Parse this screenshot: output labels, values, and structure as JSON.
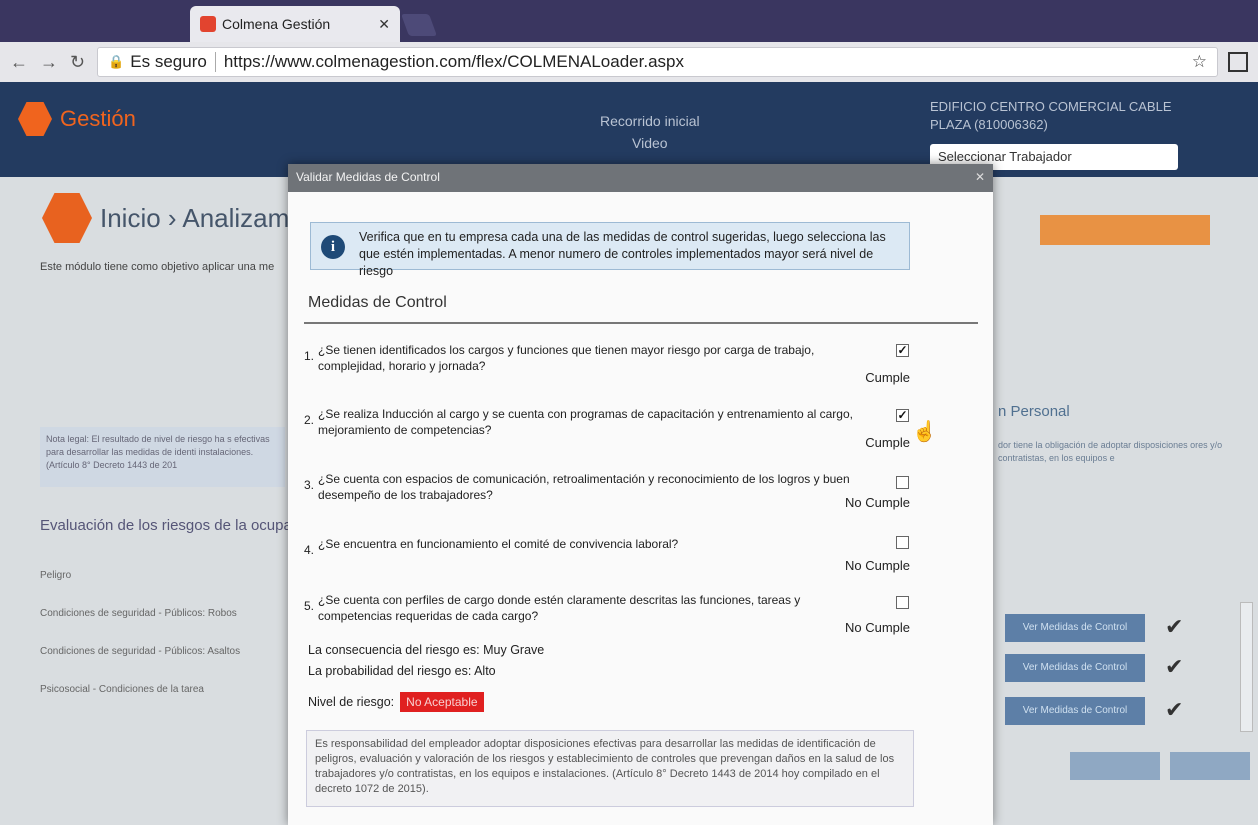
{
  "browser": {
    "tab_title": "Colmena Gestión",
    "secure_label": "Es seguro",
    "url": "https://www.colmenagestion.com/flex/COLMENALoader.aspx"
  },
  "app_header": {
    "logo_text": "Gestión",
    "tour_line1": "Recorrido inicial",
    "tour_line2": "Video",
    "company": "EDIFICIO CENTRO COMERCIAL CABLE PLAZA (810006362)",
    "worker_select": "Seleccionar Trabajador"
  },
  "background": {
    "breadcrumb": "Inicio  ›  Analizamos",
    "description": "Este módulo tiene como objetivo aplicar una me",
    "note": "Nota legal: El resultado de nivel de riesgo ha s efectivas para desarrollar las medidas de identi instalaciones. (Artículo 8° Decreto 1443 de 201",
    "section_title": "Evaluación de los riesgos de la ocupac",
    "table_header": "Peligro",
    "rows": [
      "Condiciones de seguridad - Públicos: Robos",
      "Condiciones de seguridad - Públicos: Asaltos",
      "Psicosocial - Condiciones de la tarea"
    ],
    "right_title": "n Personal",
    "right_note": "dor tiene la obligación de adoptar disposiciones ores y/o contratistas, en los equipos e",
    "ver_medidas_label": "Ver Medidas de Control"
  },
  "modal": {
    "title": "Validar Medidas de Control",
    "info": "Verifica que en tu empresa cada una de las medidas de control sugeridas, luego selecciona las que estén implementadas. A menor numero de controles implementados mayor será nivel de riesgo",
    "heading": "Medidas de Control",
    "questions": [
      {
        "num": "1.",
        "text": "¿Se tienen identificados los cargos y funciones que tienen mayor riesgo por carga de trabajo, complejidad, horario y jornada?",
        "checked": true,
        "status": "Cumple"
      },
      {
        "num": "2.",
        "text": "¿Se realiza Inducción al cargo y se cuenta con programas de  capacitación y entrenamiento al cargo, mejoramiento de competencias?",
        "checked": true,
        "status": "Cumple"
      },
      {
        "num": "3.",
        "text": "¿Se cuenta con espacios de comunicación, retroalimentación y reconocimiento de los logros y buen desempeño de los trabajadores?",
        "checked": false,
        "status": "No Cumple"
      },
      {
        "num": "4.",
        "text": "¿Se encuentra en funcionamiento el comité de convivencia laboral?",
        "checked": false,
        "status": "No Cumple"
      },
      {
        "num": "5.",
        "text": "¿Se cuenta con perfiles de cargo donde estén claramente descritas las funciones, tareas y competencias requeridas de cada cargo?",
        "checked": false,
        "status": "No Cumple"
      }
    ],
    "consecuencia": "La consecuencia del riesgo es: Muy Grave",
    "probabilidad": "La probabilidad del riesgo es: Alto",
    "nivel_label": "Nivel de riesgo:",
    "nivel_value": "No Aceptable",
    "nivel_color": "#e02020",
    "legal": "Es responsabilidad del empleador adoptar disposiciones efectivas para desarrollar las medidas de identificación de peligros, evaluación y valoración de los riesgos y establecimiento de controles que prevengan daños en la salud de los trabajadores y/o contratistas, en los equipos e instalaciones. (Artículo 8° Decreto 1443 de 2014 hoy compilado en el decreto 1072 de 2015)."
  }
}
